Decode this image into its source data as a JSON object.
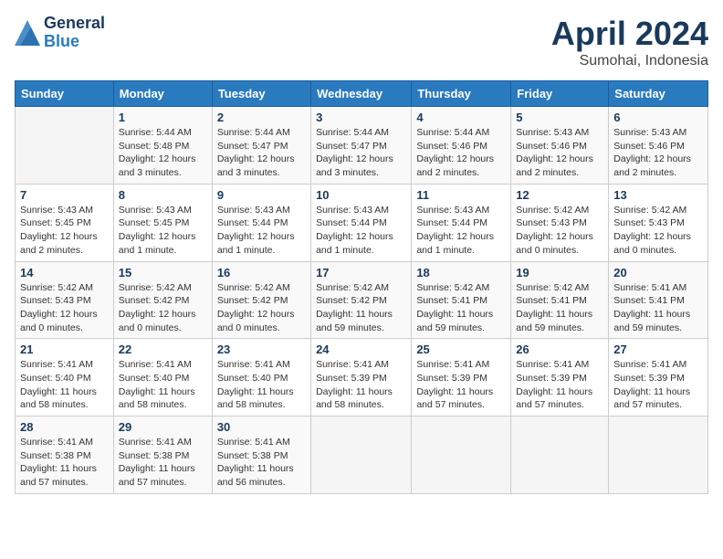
{
  "logo": {
    "general": "General",
    "blue": "Blue"
  },
  "title": "April 2024",
  "subtitle": "Sumohai, Indonesia",
  "days_of_week": [
    "Sunday",
    "Monday",
    "Tuesday",
    "Wednesday",
    "Thursday",
    "Friday",
    "Saturday"
  ],
  "weeks": [
    [
      {
        "day": "",
        "info": ""
      },
      {
        "day": "1",
        "info": "Sunrise: 5:44 AM\nSunset: 5:48 PM\nDaylight: 12 hours\nand 3 minutes."
      },
      {
        "day": "2",
        "info": "Sunrise: 5:44 AM\nSunset: 5:47 PM\nDaylight: 12 hours\nand 3 minutes."
      },
      {
        "day": "3",
        "info": "Sunrise: 5:44 AM\nSunset: 5:47 PM\nDaylight: 12 hours\nand 3 minutes."
      },
      {
        "day": "4",
        "info": "Sunrise: 5:44 AM\nSunset: 5:46 PM\nDaylight: 12 hours\nand 2 minutes."
      },
      {
        "day": "5",
        "info": "Sunrise: 5:43 AM\nSunset: 5:46 PM\nDaylight: 12 hours\nand 2 minutes."
      },
      {
        "day": "6",
        "info": "Sunrise: 5:43 AM\nSunset: 5:46 PM\nDaylight: 12 hours\nand 2 minutes."
      }
    ],
    [
      {
        "day": "7",
        "info": "Sunrise: 5:43 AM\nSunset: 5:45 PM\nDaylight: 12 hours\nand 2 minutes."
      },
      {
        "day": "8",
        "info": "Sunrise: 5:43 AM\nSunset: 5:45 PM\nDaylight: 12 hours\nand 1 minute."
      },
      {
        "day": "9",
        "info": "Sunrise: 5:43 AM\nSunset: 5:44 PM\nDaylight: 12 hours\nand 1 minute."
      },
      {
        "day": "10",
        "info": "Sunrise: 5:43 AM\nSunset: 5:44 PM\nDaylight: 12 hours\nand 1 minute."
      },
      {
        "day": "11",
        "info": "Sunrise: 5:43 AM\nSunset: 5:44 PM\nDaylight: 12 hours\nand 1 minute."
      },
      {
        "day": "12",
        "info": "Sunrise: 5:42 AM\nSunset: 5:43 PM\nDaylight: 12 hours\nand 0 minutes."
      },
      {
        "day": "13",
        "info": "Sunrise: 5:42 AM\nSunset: 5:43 PM\nDaylight: 12 hours\nand 0 minutes."
      }
    ],
    [
      {
        "day": "14",
        "info": "Sunrise: 5:42 AM\nSunset: 5:43 PM\nDaylight: 12 hours\nand 0 minutes."
      },
      {
        "day": "15",
        "info": "Sunrise: 5:42 AM\nSunset: 5:42 PM\nDaylight: 12 hours\nand 0 minutes."
      },
      {
        "day": "16",
        "info": "Sunrise: 5:42 AM\nSunset: 5:42 PM\nDaylight: 12 hours\nand 0 minutes."
      },
      {
        "day": "17",
        "info": "Sunrise: 5:42 AM\nSunset: 5:42 PM\nDaylight: 11 hours\nand 59 minutes."
      },
      {
        "day": "18",
        "info": "Sunrise: 5:42 AM\nSunset: 5:41 PM\nDaylight: 11 hours\nand 59 minutes."
      },
      {
        "day": "19",
        "info": "Sunrise: 5:42 AM\nSunset: 5:41 PM\nDaylight: 11 hours\nand 59 minutes."
      },
      {
        "day": "20",
        "info": "Sunrise: 5:41 AM\nSunset: 5:41 PM\nDaylight: 11 hours\nand 59 minutes."
      }
    ],
    [
      {
        "day": "21",
        "info": "Sunrise: 5:41 AM\nSunset: 5:40 PM\nDaylight: 11 hours\nand 58 minutes."
      },
      {
        "day": "22",
        "info": "Sunrise: 5:41 AM\nSunset: 5:40 PM\nDaylight: 11 hours\nand 58 minutes."
      },
      {
        "day": "23",
        "info": "Sunrise: 5:41 AM\nSunset: 5:40 PM\nDaylight: 11 hours\nand 58 minutes."
      },
      {
        "day": "24",
        "info": "Sunrise: 5:41 AM\nSunset: 5:39 PM\nDaylight: 11 hours\nand 58 minutes."
      },
      {
        "day": "25",
        "info": "Sunrise: 5:41 AM\nSunset: 5:39 PM\nDaylight: 11 hours\nand 57 minutes."
      },
      {
        "day": "26",
        "info": "Sunrise: 5:41 AM\nSunset: 5:39 PM\nDaylight: 11 hours\nand 57 minutes."
      },
      {
        "day": "27",
        "info": "Sunrise: 5:41 AM\nSunset: 5:39 PM\nDaylight: 11 hours\nand 57 minutes."
      }
    ],
    [
      {
        "day": "28",
        "info": "Sunrise: 5:41 AM\nSunset: 5:38 PM\nDaylight: 11 hours\nand 57 minutes."
      },
      {
        "day": "29",
        "info": "Sunrise: 5:41 AM\nSunset: 5:38 PM\nDaylight: 11 hours\nand 57 minutes."
      },
      {
        "day": "30",
        "info": "Sunrise: 5:41 AM\nSunset: 5:38 PM\nDaylight: 11 hours\nand 56 minutes."
      },
      {
        "day": "",
        "info": ""
      },
      {
        "day": "",
        "info": ""
      },
      {
        "day": "",
        "info": ""
      },
      {
        "day": "",
        "info": ""
      }
    ]
  ]
}
